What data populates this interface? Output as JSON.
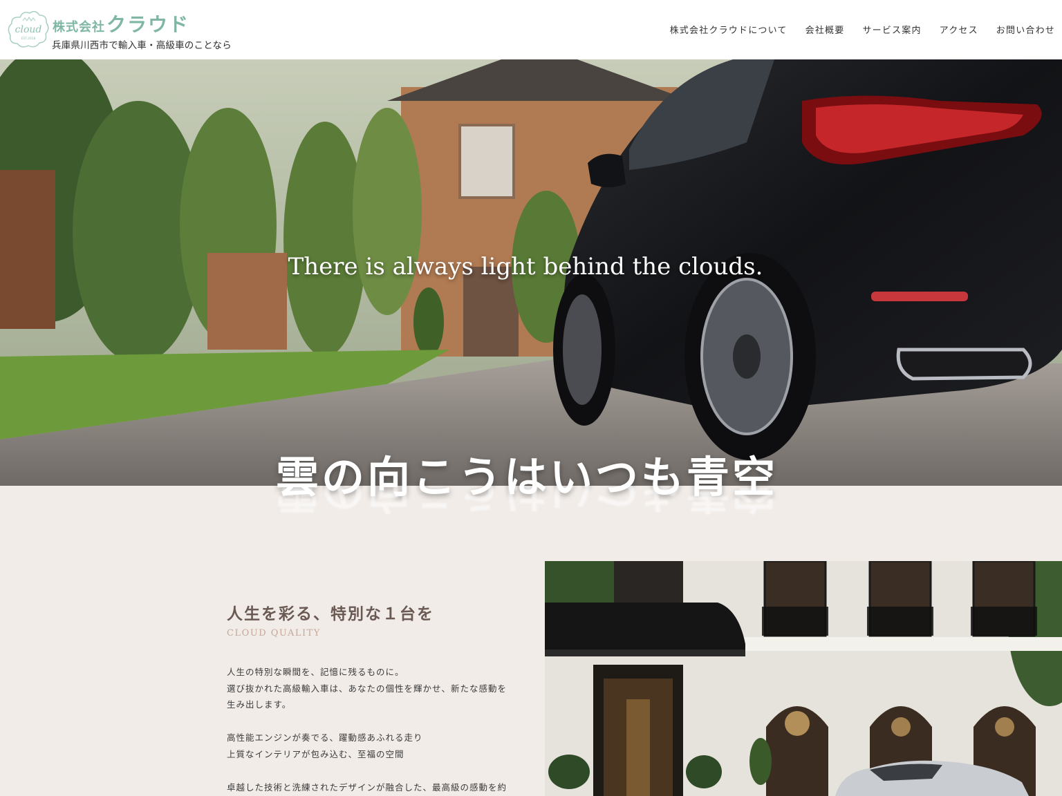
{
  "header": {
    "logo": {
      "text": "cloud",
      "est": "EST.2018"
    },
    "brand_prefix": "株式会社",
    "brand_name": "クラウド",
    "tagline": "兵庫県川西市で輸入車・高級車のことなら"
  },
  "nav": [
    {
      "label": "株式会社クラウドについて"
    },
    {
      "label": "会社概要"
    },
    {
      "label": "サービス案内"
    },
    {
      "label": "アクセス"
    },
    {
      "label": "お問い合わせ"
    }
  ],
  "hero": {
    "subtitle": "There is always light behind the clouds.",
    "title": "雲の向こうはいつも青空"
  },
  "content": {
    "heading": "人生を彩る、特別な１台を",
    "subheading": "CLOUD QUALITY",
    "paragraphs": [
      [
        "人生の特別な瞬間を、記憶に残るものに。",
        "選び抜かれた高級輸入車は、あなたの個性を輝かせ、新たな感動を",
        "生み出します。"
      ],
      [
        "高性能エンジンが奏でる、躍動感あふれる走り",
        "上質なインテリアが包み込む、至福の空間"
      ],
      [
        "卓越した技術と洗練されたデザインが融合した、最高級の感動を約"
      ]
    ]
  },
  "colors": {
    "brand": "#7fb6a4",
    "background": "#f1ece8",
    "heading": "#6b5a54",
    "accent_sub": "#c4a89a"
  }
}
